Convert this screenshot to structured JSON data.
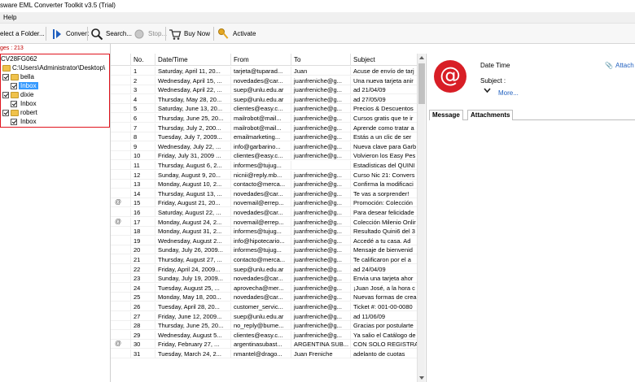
{
  "window": {
    "title": "sware EML Converter Toolkit v3.5 (Trial)"
  },
  "menu": {
    "help": "Help"
  },
  "toolbar": {
    "select_folder": "elect a Folder...",
    "convert": "Convert",
    "search": "Search...",
    "stop": "Stop...",
    "buy_now": "Buy Now",
    "activate": "Activate"
  },
  "left_pane": {
    "pages_label": "ges : 213",
    "root": "CV28FG062",
    "path": "C:\\Users\\Administrator\\Desktop\\",
    "folders": [
      {
        "name": "bella",
        "child": "Inbox"
      },
      {
        "name": "dixie",
        "child": "Inbox"
      },
      {
        "name": "robert",
        "child": "Inbox"
      }
    ]
  },
  "grid": {
    "headers": {
      "no": "No.",
      "datetime": "Date/Time",
      "from": "From",
      "to": "To",
      "subject": "Subject"
    },
    "attachment_glyph": "@",
    "rows": [
      {
        "no": "1",
        "date": "Saturday, April 11, 20...",
        "from": "tarjeta@tuparad...",
        "to": "Juan",
        "subject": "Acuse de envío de tarj",
        "att": false
      },
      {
        "no": "2",
        "date": "Wednesday, April 15, ...",
        "from": "novedades@car...",
        "to": "juanfreniche@g...",
        "subject": "Una nueva tarjeta anir",
        "att": false
      },
      {
        "no": "3",
        "date": "Wednesday, April 22, ...",
        "from": "suep@unlu.edu.ar",
        "to": "juanfreniche@g...",
        "subject": "ad 21/04/09",
        "att": false
      },
      {
        "no": "4",
        "date": "Thursday, May 28, 20...",
        "from": "suep@unlu.edu.ar",
        "to": "juanfreniche@g...",
        "subject": "ad 27/05/09",
        "att": false
      },
      {
        "no": "5",
        "date": "Saturday, June 13, 20...",
        "from": "clientes@easy.c...",
        "to": "juanfreniche@g...",
        "subject": "Precios & Descuentos",
        "att": false
      },
      {
        "no": "6",
        "date": "Thursday, June 25, 20...",
        "from": "mailrobot@mail...",
        "to": "juanfreniche@g...",
        "subject": "Cursos gratis que te ir",
        "att": false
      },
      {
        "no": "7",
        "date": "Thursday, July 2, 200...",
        "from": "mailrobot@mail...",
        "to": "juanfreniche@g...",
        "subject": "Aprende como tratar a",
        "att": false
      },
      {
        "no": "8",
        "date": "Tuesday, July 7, 2009...",
        "from": "emailmarketing...",
        "to": "juanfreniche@g...",
        "subject": "Estás a un clic de ser",
        "att": false
      },
      {
        "no": "9",
        "date": "Wednesday, July 22, ...",
        "from": "info@garbarino...",
        "to": "juanfreniche@g...",
        "subject": "Nueva clave para Garb",
        "att": false
      },
      {
        "no": "10",
        "date": "Friday, July 31, 2009 ...",
        "from": "clientes@easy.c...",
        "to": "juanfreniche@g...",
        "subject": "Volvieron los Easy Pes",
        "att": false
      },
      {
        "no": "11",
        "date": "Thursday, August 6, 2...",
        "from": "informes@tujug...",
        "to": "",
        "subject": "Estadísticas del QUINI",
        "att": false
      },
      {
        "no": "12",
        "date": "Sunday, August 9, 20...",
        "from": "nicnii@reply.mb...",
        "to": "juanfreniche@g...",
        "subject": "Curso Nic 21: Convers",
        "att": false
      },
      {
        "no": "13",
        "date": "Monday, August 10, 2...",
        "from": "contacto@merca...",
        "to": "juanfreniche@g...",
        "subject": "Confirma la modificaci",
        "att": false
      },
      {
        "no": "14",
        "date": "Thursday, August 13, ...",
        "from": "novedades@car...",
        "to": "juanfreniche@g...",
        "subject": "Te vas a sorprender!",
        "att": false
      },
      {
        "no": "15",
        "date": "Friday, August 21, 20...",
        "from": "novemail@errep...",
        "to": "juanfreniche@g...",
        "subject": "Promoción: Colección",
        "att": true
      },
      {
        "no": "16",
        "date": "Saturday, August 22, ...",
        "from": "novedades@car...",
        "to": "juanfreniche@g...",
        "subject": "Para desear felicidade",
        "att": false
      },
      {
        "no": "17",
        "date": "Monday, August 24, 2...",
        "from": "novemail@errep...",
        "to": "juanfreniche@g...",
        "subject": "Colección Milenio Onlir",
        "att": true
      },
      {
        "no": "18",
        "date": "Monday, August 31, 2...",
        "from": "informes@tujug...",
        "to": "juanfreniche@g...",
        "subject": "Resultado Quini6 del 3",
        "att": false
      },
      {
        "no": "19",
        "date": "Wednesday, August 2...",
        "from": "info@hipotecario...",
        "to": "juanfreniche@g...",
        "subject": "Accedé a tu casa.  Ad",
        "att": false
      },
      {
        "no": "20",
        "date": "Sunday, July 26, 2009...",
        "from": "informes@tujug...",
        "to": "juanfreniche@g...",
        "subject": "Mensaje de bienvenid",
        "att": false
      },
      {
        "no": "21",
        "date": "Thursday, August 27, ...",
        "from": "contacto@merca...",
        "to": "juanfreniche@g...",
        "subject": "Te calificaron por el a",
        "att": false
      },
      {
        "no": "22",
        "date": "Friday, April 24, 2009...",
        "from": "suep@unlu.edu.ar",
        "to": "juanfreniche@g...",
        "subject": "ad 24/04/09",
        "att": false
      },
      {
        "no": "23",
        "date": "Sunday, July 19, 2009...",
        "from": "novedades@car...",
        "to": "juanfreniche@g...",
        "subject": "Envia una tarjeta ahor",
        "att": false
      },
      {
        "no": "24",
        "date": "Tuesday, August 25, ...",
        "from": "aprovecha@mer...",
        "to": "juanfreniche@g...",
        "subject": "¡Juan José, a la hora c",
        "att": false
      },
      {
        "no": "25",
        "date": "Monday, May 18, 200...",
        "from": "novedades@car...",
        "to": "juanfreniche@g...",
        "subject": "Nuevas formas de crea",
        "att": false
      },
      {
        "no": "26",
        "date": "Tuesday, April 28, 20...",
        "from": "customer_servic...",
        "to": "juanfreniche@g...",
        "subject": "Ticket #: 001-00-0080",
        "att": false
      },
      {
        "no": "27",
        "date": "Friday, June 12, 2009...",
        "from": "suep@unlu.edu.ar",
        "to": "juanfreniche@g...",
        "subject": "ad  11/06/09",
        "att": false
      },
      {
        "no": "28",
        "date": "Thursday, June 25, 20...",
        "from": "no_reply@bume...",
        "to": "juanfreniche@g...",
        "subject": "Gracias por postularte",
        "att": false
      },
      {
        "no": "29",
        "date": "Wednesday, August 5...",
        "from": "clientes@easy.c...",
        "to": "juanfreniche@g...",
        "subject": "Ya salio el Catálogo de",
        "att": false
      },
      {
        "no": "30",
        "date": "Friday, February 27, ...",
        "from": "argentinasubast...",
        "to": "ARGENTINA SUB...",
        "subject": "CON SOLO REGISTRAI",
        "att": true
      },
      {
        "no": "31",
        "date": "Tuesday, March 24, 2...",
        "from": "nmantel@drago...",
        "to": "Juan Freniche",
        "subject": "adelanto de cuotas",
        "att": false
      }
    ]
  },
  "preview": {
    "datetime_label": "Date Time",
    "subject_label": "Subject :",
    "attach_label": "Attach",
    "more_label": "More...",
    "tabs": [
      "Message",
      "Attachments"
    ],
    "at_glyph": "@",
    "accent_color": "#d81e26"
  },
  "colors": {
    "selection": "#3399ff",
    "tree_border": "#e0141e",
    "pages_label": "#c00000"
  }
}
